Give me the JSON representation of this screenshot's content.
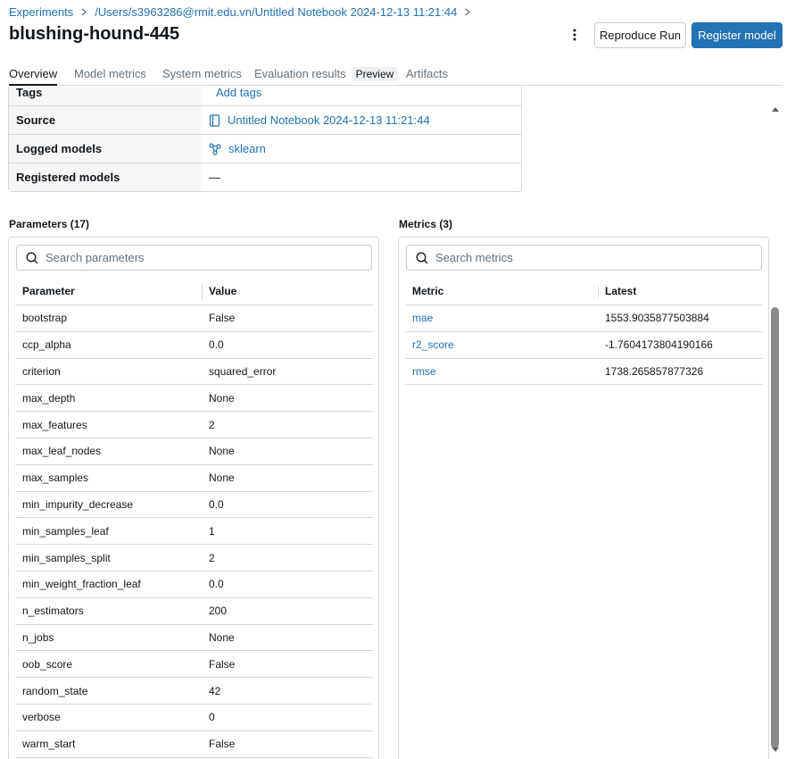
{
  "breadcrumb": {
    "experiments": "Experiments",
    "path": "/Users/s3963286@rmit.edu.vn/Untitled Notebook 2024-12-13 11:21:44"
  },
  "run_name": "blushing-hound-445",
  "actions": {
    "more_icon": "kebab-vertical-icon",
    "reproduce": "Reproduce Run",
    "register": "Register model"
  },
  "tabs": [
    {
      "label": "Overview",
      "active": true
    },
    {
      "label": "Model metrics"
    },
    {
      "label": "System metrics"
    },
    {
      "label": "Evaluation results",
      "badge": "Preview"
    },
    {
      "label": "Artifacts"
    }
  ],
  "details": {
    "tags": {
      "key": "Tags",
      "value": "Add tags"
    },
    "source": {
      "key": "Source",
      "value": "Untitled Notebook 2024-12-13 11:21:44"
    },
    "logged_models": {
      "key": "Logged models",
      "value": "sklearn"
    },
    "registered_models": {
      "key": "Registered models",
      "value": "—"
    }
  },
  "parameters": {
    "title": "Parameters (17)",
    "search_placeholder": "Search parameters",
    "columns": [
      "Parameter",
      "Value"
    ],
    "rows": [
      [
        "bootstrap",
        "False"
      ],
      [
        "ccp_alpha",
        "0.0"
      ],
      [
        "criterion",
        "squared_error"
      ],
      [
        "max_depth",
        "None"
      ],
      [
        "max_features",
        "2"
      ],
      [
        "max_leaf_nodes",
        "None"
      ],
      [
        "max_samples",
        "None"
      ],
      [
        "min_impurity_decrease",
        "0.0"
      ],
      [
        "min_samples_leaf",
        "1"
      ],
      [
        "min_samples_split",
        "2"
      ],
      [
        "min_weight_fraction_leaf",
        "0.0"
      ],
      [
        "n_estimators",
        "200"
      ],
      [
        "n_jobs",
        "None"
      ],
      [
        "oob_score",
        "False"
      ],
      [
        "random_state",
        "42"
      ],
      [
        "verbose",
        "0"
      ],
      [
        "warm_start",
        "False"
      ]
    ]
  },
  "metrics": {
    "title": "Metrics (3)",
    "search_placeholder": "Search metrics",
    "columns": [
      "Metric",
      "Latest"
    ],
    "rows": [
      [
        "mae",
        "1553.9035877503884"
      ],
      [
        "r2_score",
        "-1.7604173804190166"
      ],
      [
        "rmse",
        "1738.265857877326"
      ]
    ]
  },
  "colors": {
    "accent": "#2272b4",
    "border": "#d1d9e1",
    "text": "#11171c",
    "muted": "#5f7281"
  }
}
